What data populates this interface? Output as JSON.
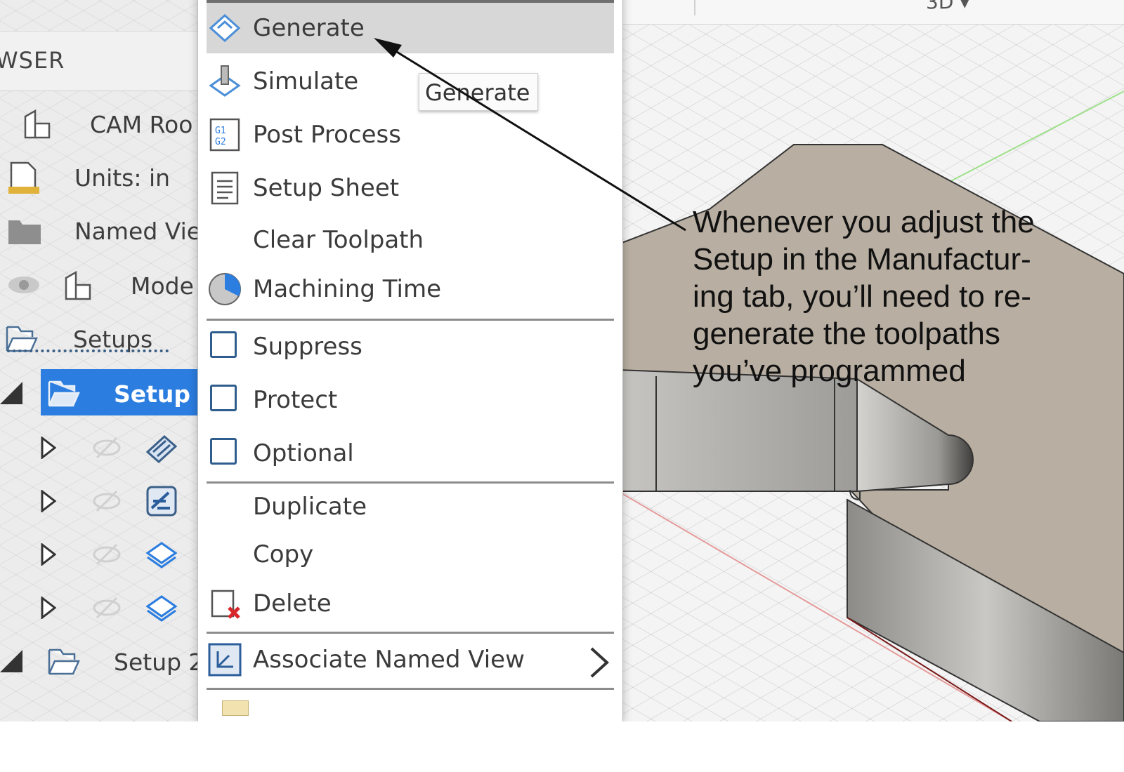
{
  "browser": {
    "title_fragment": "WSER",
    "rows": [
      {
        "label": "CAM Roo",
        "icon": "component-icon"
      },
      {
        "label": "Units: in",
        "icon": "units-document-icon"
      },
      {
        "label": "Named Vie",
        "icon": "folder-icon"
      },
      {
        "label": "Mode",
        "icon": "component-icon"
      },
      {
        "label": "Setups",
        "icon": "setups-folder-icon"
      },
      {
        "label": "Setup",
        "icon": "setup-folder-icon",
        "selected": true
      },
      {
        "label": "Setup 2",
        "icon": "setup-folder-icon"
      }
    ]
  },
  "viewport": {
    "view_mode": "3D ▾"
  },
  "menu": {
    "items": [
      {
        "label": "Generate",
        "icon": "generate-icon",
        "active": true
      },
      {
        "label": "Simulate",
        "icon": "simulate-icon"
      },
      {
        "label": "Post Process",
        "icon": "post-process-icon"
      },
      {
        "label": "Setup Sheet",
        "icon": "setup-sheet-icon"
      },
      {
        "label": "Clear Toolpath",
        "icon": ""
      },
      {
        "label": "Machining Time",
        "icon": "machining-time-icon"
      },
      {
        "label": "Suppress",
        "icon": "checkbox",
        "checked": false
      },
      {
        "label": "Protect",
        "icon": "checkbox",
        "checked": false
      },
      {
        "label": "Optional",
        "icon": "checkbox",
        "checked": false
      },
      {
        "label": "Duplicate",
        "icon": ""
      },
      {
        "label": "Copy",
        "icon": ""
      },
      {
        "label": "Delete",
        "icon": "delete-icon"
      },
      {
        "label": "Associate Named View",
        "icon": "associate-view-icon",
        "submenu": true
      }
    ]
  },
  "tooltip": {
    "text": "Generate"
  },
  "annotation": {
    "lines": [
      "Whenever you adjust the",
      "Setup in the Manufactur-",
      "ing tab, you’ll need to re-",
      "generate the toolpaths",
      "you’ve programmed"
    ]
  },
  "colors": {
    "selection": "#2b7de0",
    "menu_active": "#d7d7d7",
    "part_top": "#b8aea1",
    "part_side": "#a9a9a6"
  }
}
